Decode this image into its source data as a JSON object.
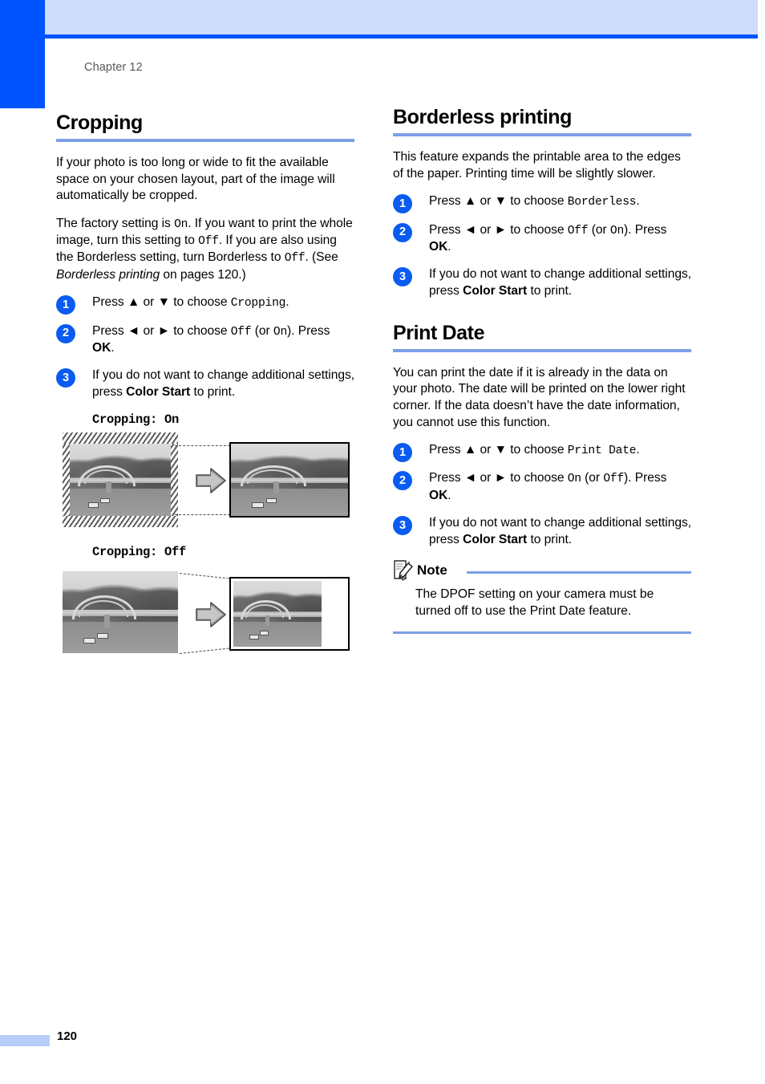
{
  "page": {
    "chapter_label": "Chapter 12",
    "page_number": "120",
    "accent_blue": "#0054ff",
    "rule_blue": "#7e9fe8",
    "header_band_blue": "#cfdcfb",
    "footer_bar_blue": "#b8cdf8",
    "step_circle_blue": "#0a5bf0"
  },
  "left_column": {
    "heading": "Cropping",
    "intro_paragraph": "If your photo is too long or wide to fit the available space on your chosen layout, part of the image will automatically be cropped.",
    "factory_paragraph": {
      "t1": "The factory setting is ",
      "m1": "On",
      "t2": ". If you want to print the whole image, turn this setting to ",
      "m2": "Off",
      "t3": ". If you are also using the Borderless setting, turn Borderless to ",
      "m3": "Off",
      "t4": ". (See ",
      "i1": "Borderless printing",
      "t5": " on pages 120.)"
    },
    "steps": [
      {
        "num": "1",
        "t1": "Press ▲ or ▼ to choose ",
        "m1": "Cropping",
        "t2": "."
      },
      {
        "num": "2",
        "t1": "Press ◄ or ► to choose ",
        "m1": "Off",
        "t2": " (or ",
        "m2": "On",
        "t3": "). Press ",
        "b1": "OK",
        "t4": "."
      },
      {
        "num": "3",
        "t1": "If you do not want to change additional settings, press ",
        "b1": "Color Start",
        "t2": " to print."
      }
    ],
    "figures": [
      {
        "caption": "Cropping: On"
      },
      {
        "caption": "Cropping: Off"
      }
    ]
  },
  "right_column": {
    "borderless": {
      "heading": "Borderless printing",
      "intro_paragraph": "This feature expands the printable area to the edges of the paper. Printing time will be slightly slower.",
      "steps": [
        {
          "num": "1",
          "t1": "Press ▲ or ▼ to choose ",
          "m1": "Borderless",
          "t2": "."
        },
        {
          "num": "2",
          "t1": "Press ◄ or ► to choose ",
          "m1": "Off",
          "t2": " (or ",
          "m2": "On",
          "t3": "). Press ",
          "b1": "OK",
          "t4": "."
        },
        {
          "num": "3",
          "t1": "If you do not want to change additional settings, press ",
          "b1": "Color Start",
          "t2": " to print."
        }
      ]
    },
    "print_date": {
      "heading": "Print Date",
      "intro_paragraph": "You can print the date if it is already in the data on your photo. The date will be printed on the lower right corner. If the data doesn’t have the date information, you cannot use this function.",
      "steps": [
        {
          "num": "1",
          "t1": "Press ▲ or ▼ to choose ",
          "m1": "Print Date",
          "t2": "."
        },
        {
          "num": "2",
          "t1": "Press ◄ or ► to choose ",
          "m1": "On",
          "t2": " (or ",
          "m2": "Off",
          "t3": "). Press ",
          "b1": "OK",
          "t4": "."
        },
        {
          "num": "3",
          "t1": "If you do not want to change additional settings, press ",
          "b1": "Color Start",
          "t2": " to print."
        }
      ],
      "note": {
        "title": "Note",
        "icon": "note-pencil-icon",
        "body": "The DPOF setting on your camera must be turned off to use the Print Date feature."
      }
    }
  }
}
